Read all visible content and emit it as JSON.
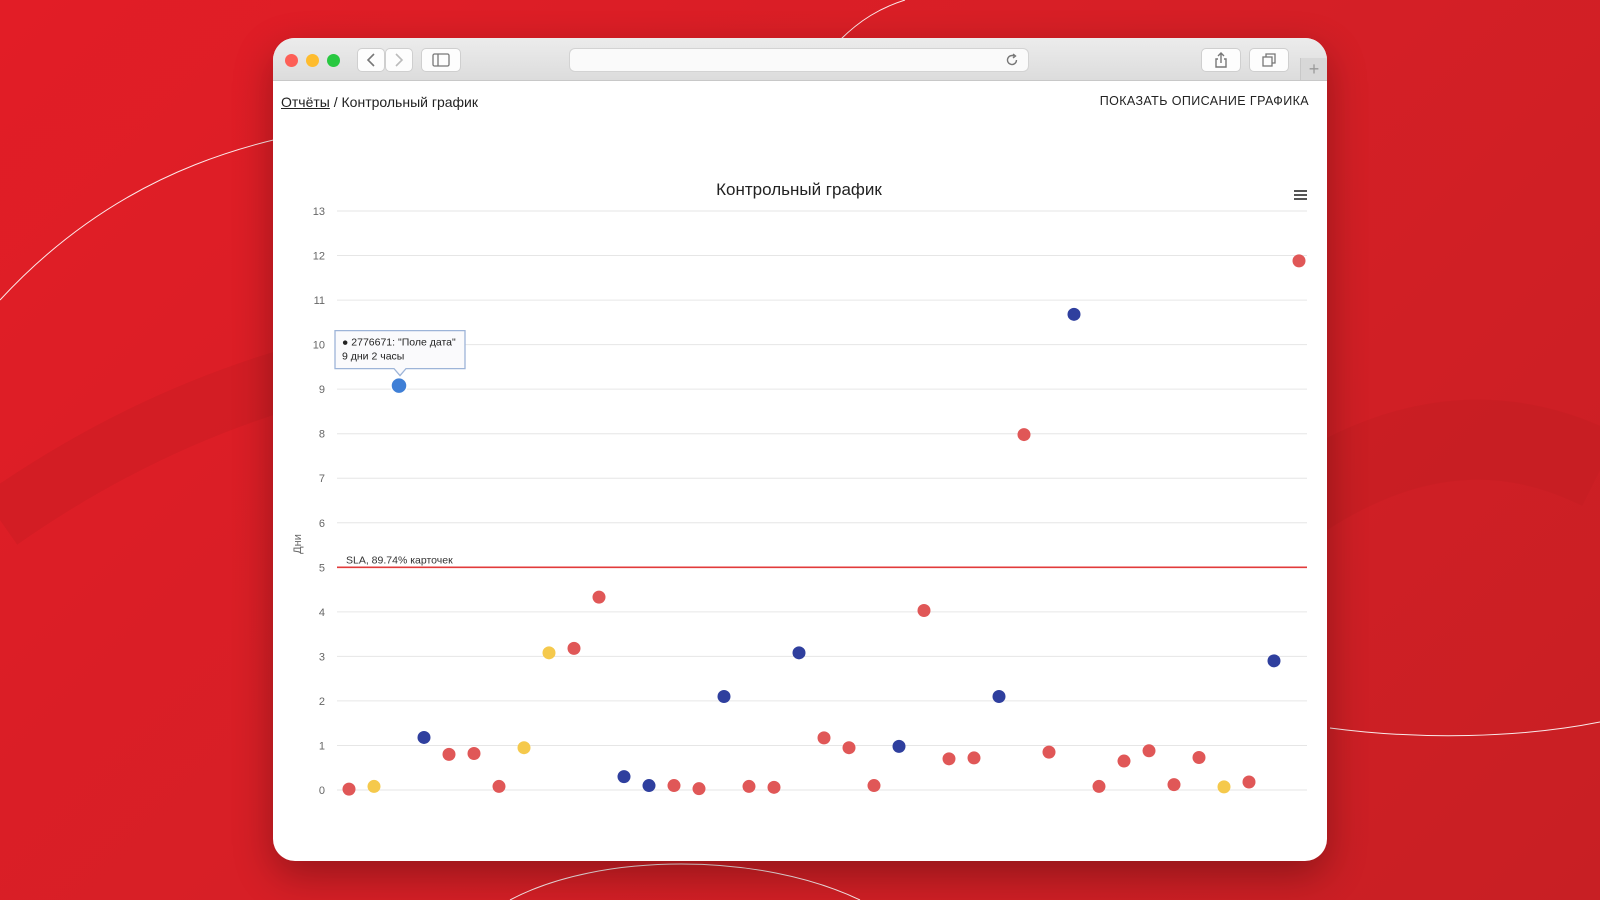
{
  "breadcrumb": {
    "parent": "Отчёты",
    "separator": "/",
    "current": "Контрольный график"
  },
  "header": {
    "show_description": "ПОКАЗАТЬ ОПИСАНИЕ ГРАФИКА"
  },
  "colors": {
    "done": "#e05757",
    "blue": "#2f3f9e",
    "yellow": "#f5c94c",
    "highlight": "#3f7fd6",
    "sla_line": "#e23b3b",
    "grid": "#e6e6e6"
  },
  "chart_data": {
    "type": "scatter",
    "title": "Контрольный график",
    "ylabel": "Дни",
    "xlabel": "",
    "ylim": [
      0,
      13
    ],
    "yticks": [
      "0",
      "1",
      "2",
      "3",
      "4",
      "5",
      "6",
      "7",
      "8",
      "9",
      "10",
      "11",
      "12",
      "13"
    ],
    "grid": true,
    "sla": {
      "value": 5,
      "label": "SLA, 89.74% карточек"
    },
    "tooltip": {
      "point_index": 2,
      "line1": "● 2776671: \"Поле дата\"",
      "line2": "9 дни 2 часы"
    },
    "points": [
      {
        "x": 0,
        "y": 0.02,
        "c": "done"
      },
      {
        "x": 1,
        "y": 0.08,
        "c": "yellow"
      },
      {
        "x": 2,
        "y": 9.08,
        "c": "highlight"
      },
      {
        "x": 3,
        "y": 1.18,
        "c": "blue"
      },
      {
        "x": 4,
        "y": 0.8,
        "c": "done"
      },
      {
        "x": 5,
        "y": 0.82,
        "c": "done"
      },
      {
        "x": 6,
        "y": 0.08,
        "c": "done"
      },
      {
        "x": 7,
        "y": 0.95,
        "c": "yellow"
      },
      {
        "x": 8,
        "y": 3.08,
        "c": "yellow"
      },
      {
        "x": 9,
        "y": 3.18,
        "c": "done"
      },
      {
        "x": 10,
        "y": 4.33,
        "c": "done"
      },
      {
        "x": 11,
        "y": 0.3,
        "c": "blue"
      },
      {
        "x": 12,
        "y": 0.1,
        "c": "blue"
      },
      {
        "x": 13,
        "y": 0.1,
        "c": "done"
      },
      {
        "x": 14,
        "y": 0.03,
        "c": "done"
      },
      {
        "x": 15,
        "y": 2.1,
        "c": "blue"
      },
      {
        "x": 16,
        "y": 0.08,
        "c": "done"
      },
      {
        "x": 17,
        "y": 0.06,
        "c": "done"
      },
      {
        "x": 18,
        "y": 3.08,
        "c": "blue"
      },
      {
        "x": 19,
        "y": 1.17,
        "c": "done"
      },
      {
        "x": 20,
        "y": 0.95,
        "c": "done"
      },
      {
        "x": 21,
        "y": 0.1,
        "c": "done"
      },
      {
        "x": 22,
        "y": 0.98,
        "c": "blue"
      },
      {
        "x": 23,
        "y": 4.03,
        "c": "done"
      },
      {
        "x": 24,
        "y": 0.7,
        "c": "done"
      },
      {
        "x": 25,
        "y": 0.72,
        "c": "done"
      },
      {
        "x": 26,
        "y": 2.1,
        "c": "blue"
      },
      {
        "x": 27,
        "y": 7.98,
        "c": "done"
      },
      {
        "x": 28,
        "y": 0.85,
        "c": "done"
      },
      {
        "x": 29,
        "y": 10.68,
        "c": "blue"
      },
      {
        "x": 30,
        "y": 0.08,
        "c": "done"
      },
      {
        "x": 31,
        "y": 0.65,
        "c": "done"
      },
      {
        "x": 32,
        "y": 0.88,
        "c": "done"
      },
      {
        "x": 33,
        "y": 0.12,
        "c": "done"
      },
      {
        "x": 34,
        "y": 0.73,
        "c": "done"
      },
      {
        "x": 35,
        "y": 0.07,
        "c": "yellow"
      },
      {
        "x": 36,
        "y": 0.18,
        "c": "done"
      },
      {
        "x": 37,
        "y": 2.9,
        "c": "blue"
      },
      {
        "x": 38,
        "y": 11.88,
        "c": "done"
      }
    ]
  }
}
